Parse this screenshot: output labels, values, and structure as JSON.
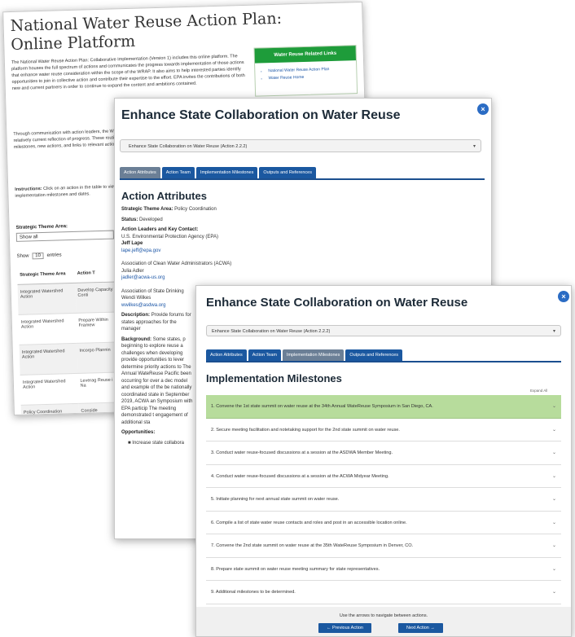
{
  "page1": {
    "title": "National Water Reuse Action Plan: Online Platform",
    "intro": "The National Water Reuse Action Plan: Collaborative Implementation (Version 1) includes this online platform. The platform houses the full spectrum of actions and communicates the progress towards implementation of those actions that enhance water reuse consideration within the scope of the WRAP. It also aims to help interested parties identify opportunities to join in collective action and contribute their expertise to the effort. EPA invites the contributions of both new and current partners in order to continue to expand the content and ambitions contained.",
    "para2": "Through communication with action leaders, the WRAP Online Platform will be updated regularly to maintain a relatively current reflection of progress. These routine action-specific updates will display progress on implementation milestones, new actions, and links to relevant action outputs.",
    "instructions_label": "Instructions:",
    "instructions": "Click on an action in the table to view information about each, including descriptions, leaders, partners, implementation milestones and dates.",
    "related_links": {
      "heading": "Water Reuse Related Links",
      "items": [
        "National Water Reuse Action Plan",
        "Water Reuse Home"
      ]
    },
    "filter": {
      "label": "Strategic Theme Area:",
      "value": "Show all"
    },
    "show_entries": {
      "prefix": "Show",
      "value": "10",
      "suffix": "entries"
    },
    "table": {
      "headers": [
        "Strategic Theme Area",
        "Action T"
      ],
      "rows": [
        [
          "Integrated Watershed Action",
          "Develop Capacity Conti"
        ],
        [
          "Integrated Watershed Action",
          "Prepare Within Framew"
        ],
        [
          "Integrated Watershed Action",
          "Incorpo Plannin"
        ],
        [
          "Integrated Watershed Action",
          "Leverag Reuse i the Na"
        ],
        [
          "Policy Coordination",
          "Conside"
        ]
      ]
    }
  },
  "page2": {
    "title": "Enhance State Collaboration on Water Reuse",
    "close": "×",
    "select_value": "Enhance State Collaboration on Water Reuse (Action 2.2.2)",
    "tabs": [
      "Action Attributes",
      "Action Team",
      "Implementation Milestones",
      "Outputs and References"
    ],
    "section": "Action Attributes",
    "theme_label": "Strategic Theme Area:",
    "theme_value": "Policy Coordination",
    "status_label": "Status:",
    "status_value": "Developed",
    "leaders_label": "Action Leaders and Key Contact:",
    "leader_org": "U.S. Environmental Protection Agency (EPA)",
    "leader_name": "Jeff Lape",
    "leader_email": "lape.jeff@epa.gov",
    "org2": "Association of Clean Water Administrators (ACWA)",
    "org2_name": "Julia Adler",
    "org2_email": "jadler@acwa-us.org",
    "org3": "Association of State Drinking",
    "org3_name": "Wendi Wilkes",
    "org3_email": "wwilkes@asdwa.org",
    "description_label": "Description:",
    "description": "Provide forums for states approaches for the manager",
    "background_label": "Background:",
    "background": "Some states, p beginning to explore reuse a challenges when developing provide opportunities to lever determine priority actions to The Annual WateReuse Pacific been occurring for over a dec model and example of the be nationally coordinated state in September 2019, ACWA an Symposium with EPA particip The meeting demonstrated t engagement of additional sta",
    "opportunities_label": "Opportunities:",
    "opportunity_item": "Increase state collabora"
  },
  "page3": {
    "title": "Enhance State Collaboration on Water Reuse",
    "close": "×",
    "select_value": "Enhance State Collaboration on Water Reuse (Action 2.2.2)",
    "tabs": [
      "Action Attributes",
      "Action Team",
      "Implementation Milestones",
      "Outputs and References"
    ],
    "section": "Implementation Milestones",
    "expand_all": "Expand All",
    "milestones": [
      "1. Convene the 1st state summit on water reuse at the 34th Annual WateReuse Symposium in San Diego, CA.",
      "2. Secure meeting facilitation and notetaking support for the 2nd state summit on water reuse.",
      "3. Conduct water reuse-focused discussions at a session at the ASDWA Member Meeting.",
      "4. Conduct water reuse-focused discussions at a session at the ACWA Midyear Meeting.",
      "5. Initiate planning for next annual state summit on water reuse.",
      "6. Compile a list of state water reuse contacts and roles and post in an accessible location online.",
      "7. Convene the 2nd state summit on water reuse at the 35th WateReuse Symposium in Denver, CO.",
      "8. Prepare state summit on water reuse meeting summary for state representatives.",
      "9. Additional milestones to be determined."
    ],
    "nav_hint": "Use the arrows to navigate between actions.",
    "prev_label": "← Previous Action",
    "next_label": "Next Action →"
  },
  "colors": {
    "tab_blue": "#1b58a0",
    "tab_active": "#6b7f96",
    "links_green": "#1e9c3a",
    "milestone_done": "#b7dc9c",
    "close_blue": "#2b6cc4"
  },
  "icons": {
    "close": "close-icon",
    "chevron": "chevron-down-icon"
  }
}
